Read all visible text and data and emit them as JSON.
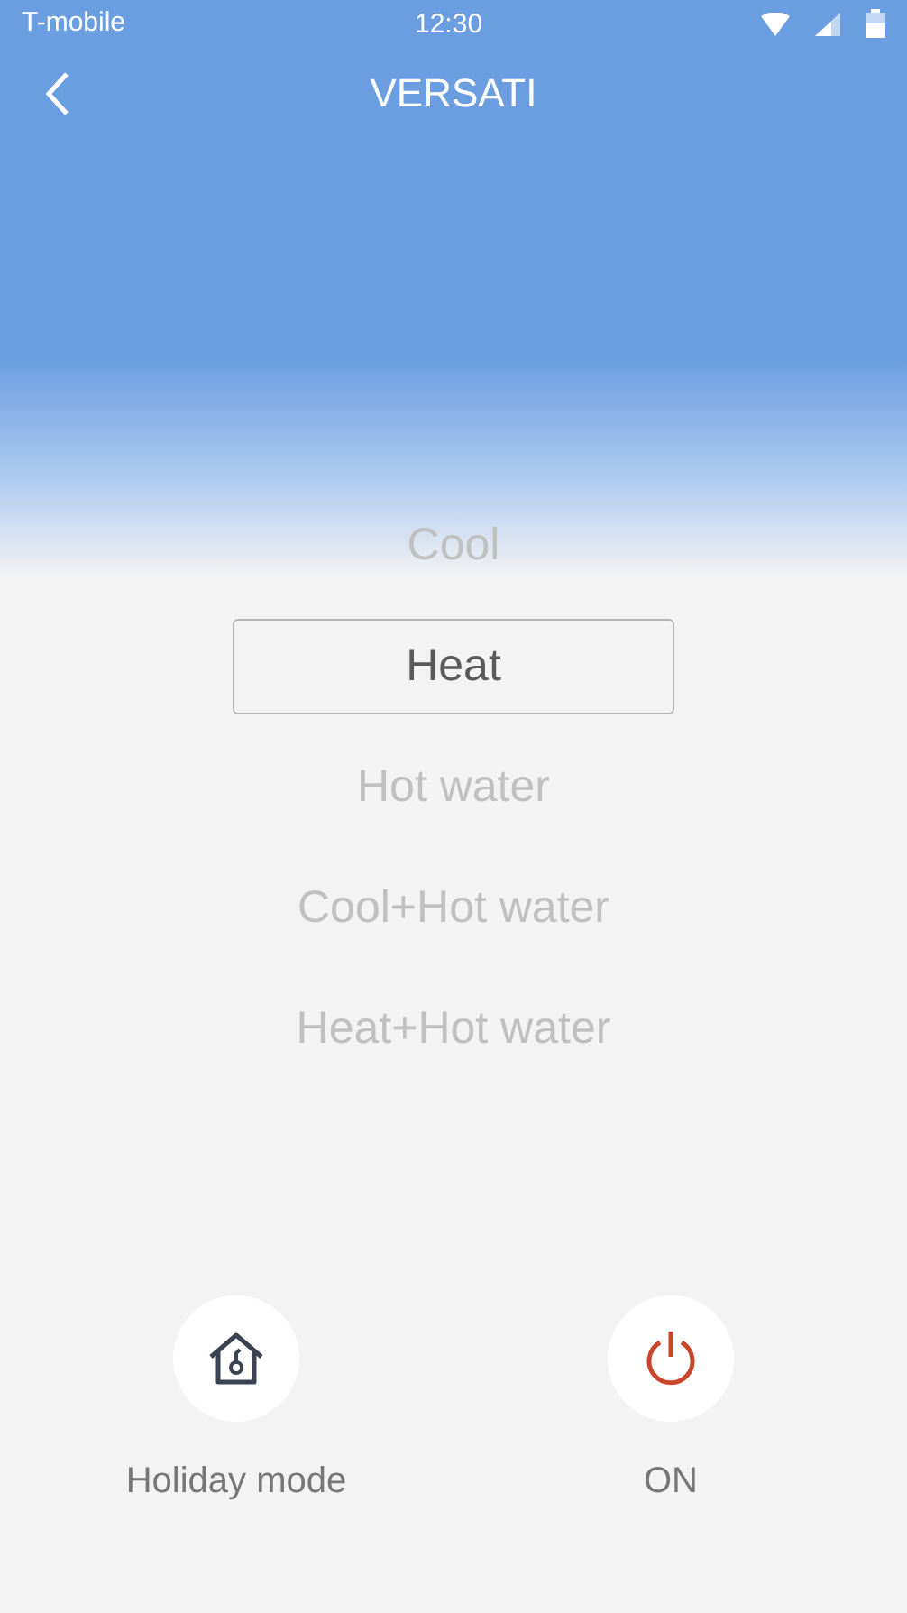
{
  "status_bar": {
    "carrier": "T-mobile",
    "time": "12:30"
  },
  "header": {
    "title": "VERSATI"
  },
  "modes": [
    {
      "label": "Cool",
      "selected": false
    },
    {
      "label": "Heat",
      "selected": true
    },
    {
      "label": "Hot water",
      "selected": false
    },
    {
      "label": "Cool+Hot water",
      "selected": false
    },
    {
      "label": "Heat+Hot water",
      "selected": false
    }
  ],
  "actions": [
    {
      "kind": "holiday",
      "label": "Holiday mode"
    },
    {
      "kind": "power",
      "label": "ON"
    }
  ]
}
